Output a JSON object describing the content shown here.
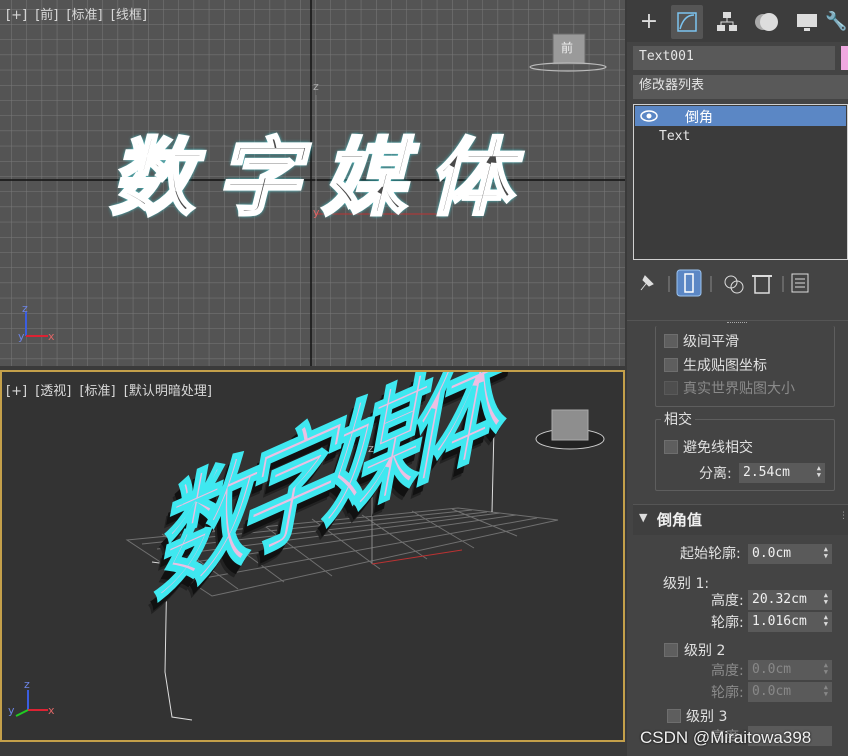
{
  "front_viewport": {
    "labels": [
      "[+]",
      "[前]",
      "[标准]",
      "[线框]"
    ],
    "text_content": "数字媒体",
    "cube_face": "前"
  },
  "persp_viewport": {
    "labels": [
      "[+]",
      "[透视]",
      "[标准]",
      "[默认明暗处理]"
    ],
    "text_content": "数字媒体"
  },
  "axis": {
    "x": "x",
    "y": "y",
    "z": "z"
  },
  "panel": {
    "tabs": [
      "create-icon",
      "modify-icon",
      "hierarchy-icon",
      "motion-icon",
      "display-icon",
      "utilities-icon"
    ],
    "object_name": "Text001",
    "modifier_list_label": "修改器列表",
    "stack": [
      {
        "label": "倒角",
        "selected": true
      },
      {
        "label": "Text",
        "selected": false
      }
    ],
    "stack_tools": [
      "pin-icon",
      "show-end-result-icon",
      "make-unique-icon",
      "delete-modifier-icon",
      "configure-icon"
    ],
    "opts": {
      "level_smooth": "级间平滑",
      "gen_map": "生成贴图坐标",
      "real_world": "真实世界贴图大小"
    },
    "intersect": {
      "title": "相交",
      "avoid": "避免线相交",
      "sep_label": "分离:",
      "sep_value": "2.54cm"
    },
    "bevel": {
      "title": "倒角值",
      "start_label": "起始轮廓:",
      "start_value": "0.0cm",
      "level1": "级别 1:",
      "l1_height_label": "高度:",
      "l1_height": "20.32cm",
      "l1_outline_label": "轮廓:",
      "l1_outline": "1.016cm",
      "level2": "级别 2",
      "l2_height_label": "高度:",
      "l2_height": "0.0cm",
      "l2_outline_label": "轮廓:",
      "l2_outline": "0.0cm",
      "level3": "级别 3",
      "l3_height_label": "高度:"
    }
  },
  "watermark": "CSDN @Miraitowa398",
  "colors": {
    "selected": "#5b87c5",
    "highlight_outline": "#3fe8f0",
    "text_face": "#ecbfe3",
    "active_border": "#c4a04a"
  }
}
